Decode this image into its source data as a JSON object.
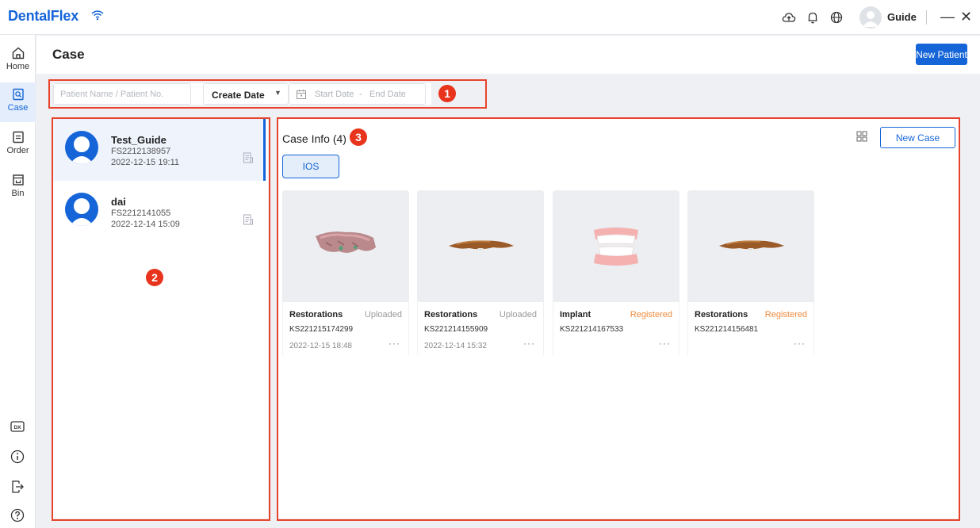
{
  "app": {
    "name": "DentalFlex"
  },
  "topbar": {
    "user_name": "Guide",
    "minimize": "—",
    "close": "✕"
  },
  "sidebar": {
    "items": [
      {
        "label": "Home",
        "icon": "home-icon"
      },
      {
        "label": "Case",
        "icon": "case-search-icon",
        "active": true
      },
      {
        "label": "Order",
        "icon": "order-icon"
      },
      {
        "label": "Bin",
        "icon": "bin-icon"
      }
    ],
    "bottom_icons": [
      "dx-icon",
      "info-icon",
      "logout-icon",
      "help-icon"
    ],
    "dx_label": "DX"
  },
  "page": {
    "title": "Case",
    "new_patient_label": "New Patient"
  },
  "filter": {
    "search_placeholder": "Patient Name / Patient No.",
    "date_type": "Create Date",
    "start_placeholder": "Start Date",
    "separator": "-",
    "end_placeholder": "End Date"
  },
  "annotations": [
    "1",
    "2",
    "3"
  ],
  "patients": [
    {
      "name": "Test_Guide",
      "number": "FS2212138957",
      "date": "2022-12-15 19:11",
      "selected": true
    },
    {
      "name": "dai",
      "number": "FS2212141055",
      "date": "2022-12-14 15:09",
      "selected": false
    }
  ],
  "case_info": {
    "title": "Case Info (4)",
    "new_case_label": "New Case",
    "tabs": [
      "IOS"
    ],
    "cards": [
      {
        "type": "Restorations",
        "status": "Uploaded",
        "number": "KS221215174299",
        "date": "2022-12-15 18:48",
        "more": "···"
      },
      {
        "type": "Restorations",
        "status": "Uploaded",
        "number": "KS221214155909",
        "date": "2022-12-14 15:32",
        "more": "···"
      },
      {
        "type": "Implant",
        "status": "Registered",
        "number": "KS221214167533",
        "date": "",
        "more": "···"
      },
      {
        "type": "Restorations",
        "status": "Registered",
        "number": "KS221214156481",
        "date": "",
        "more": "···"
      }
    ]
  },
  "colors": {
    "brand": "#1565d8",
    "annotation": "#e8432c",
    "registered": "#f08a3c"
  }
}
